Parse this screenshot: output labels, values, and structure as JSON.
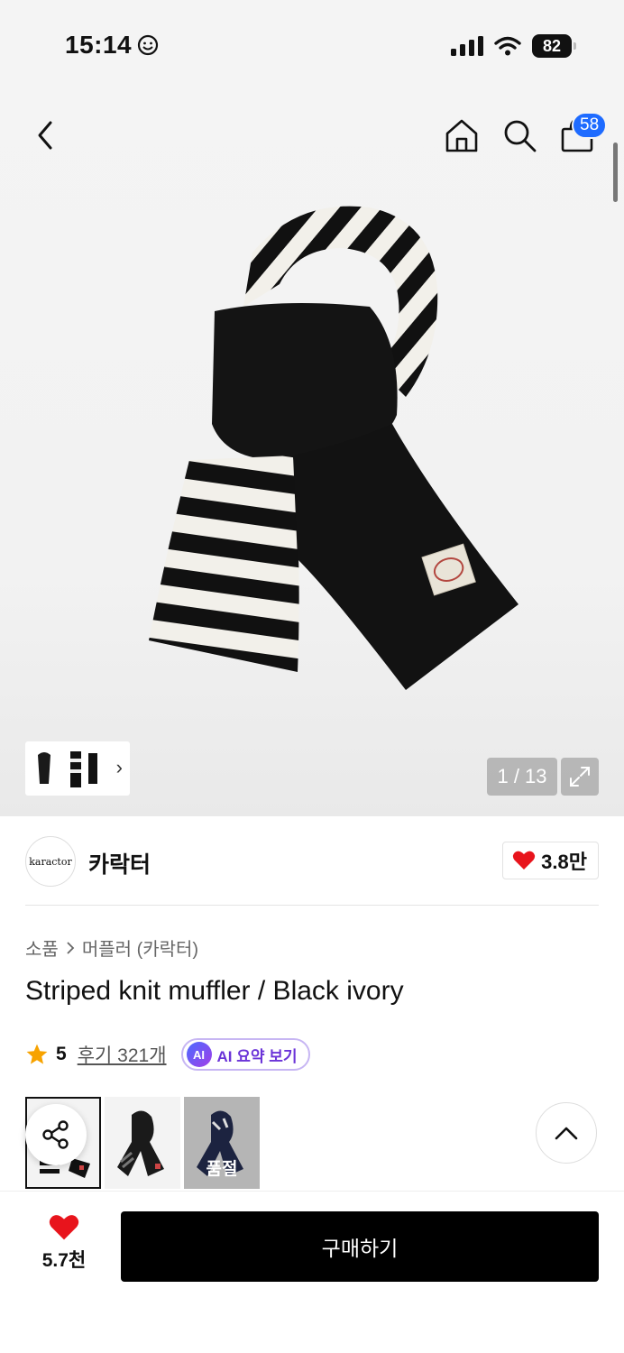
{
  "status_bar": {
    "time": "15:14",
    "battery": "82"
  },
  "nav": {
    "cart_count": "58"
  },
  "gallery": {
    "page_counter": "1 / 13"
  },
  "brand": {
    "logo_text": "karactor",
    "name": "카락터",
    "likes": "3.8만"
  },
  "breadcrumb": {
    "category": "소품",
    "subcategory": "머플러 (카락터)"
  },
  "product": {
    "title": "Striped knit muffler / Black ivory",
    "rating": "5",
    "review_link": "후기 321개",
    "ai_badge": "AI",
    "ai_summary_label": "AI 요약 보기"
  },
  "variants": [
    {
      "soldout": false
    },
    {
      "soldout": false
    },
    {
      "soldout": true,
      "label": "품절"
    }
  ],
  "bottom_bar": {
    "like_count": "5.7천",
    "buy_label": "구매하기"
  },
  "colors": {
    "accent_blue": "#1e6bff",
    "heart_red": "#e8141c",
    "ai_purple": "#6b34d8"
  }
}
